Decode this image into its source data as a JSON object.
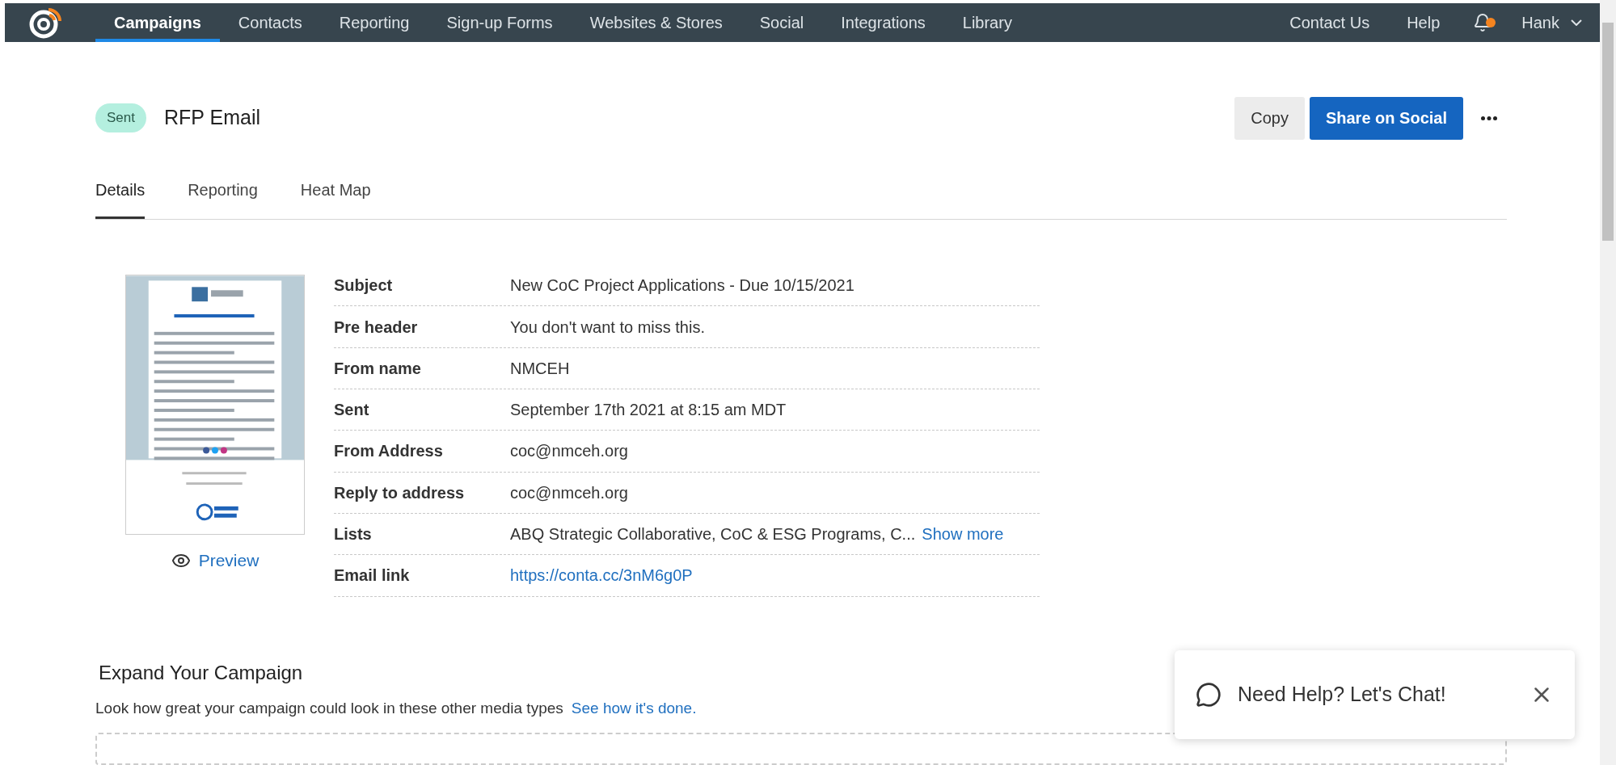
{
  "nav": {
    "items": [
      {
        "label": "Campaigns",
        "selected": true
      },
      {
        "label": "Contacts",
        "selected": false
      },
      {
        "label": "Reporting",
        "selected": false
      },
      {
        "label": "Sign-up Forms",
        "selected": false
      },
      {
        "label": "Websites & Stores",
        "selected": false
      },
      {
        "label": "Social",
        "selected": false
      },
      {
        "label": "Integrations",
        "selected": false
      },
      {
        "label": "Library",
        "selected": false
      }
    ],
    "right_links": [
      "Contact Us",
      "Help"
    ],
    "notification_dot": true,
    "user": "Hank"
  },
  "campaign": {
    "status": "Sent",
    "title": "RFP Email",
    "buttons": [
      {
        "label": "Copy",
        "kind": "secondary"
      },
      {
        "label": "Share on Social",
        "kind": "primary"
      }
    ]
  },
  "tabs": [
    {
      "label": "Details",
      "selected": true
    },
    {
      "label": "Reporting",
      "selected": false
    },
    {
      "label": "Heat Map",
      "selected": false
    }
  ],
  "preview": {
    "label": "Preview"
  },
  "details": [
    {
      "label": "Subject",
      "value": "New CoC Project Applications - Due 10/15/2021",
      "kind": "text"
    },
    {
      "label": "Pre header",
      "value": "You don't want to miss this.",
      "kind": "text"
    },
    {
      "label": "From name",
      "value": "NMCEH",
      "kind": "text"
    },
    {
      "label": "Sent",
      "value": "September 17th 2021 at 8:15 am MDT",
      "kind": "text"
    },
    {
      "label": "From Address",
      "value": "coc@nmceh.org",
      "kind": "text"
    },
    {
      "label": "Reply to address",
      "value": "coc@nmceh.org",
      "kind": "text"
    },
    {
      "label": "Lists",
      "value": "ABQ Strategic Collaborative, CoC & ESG Programs, C...",
      "link": "Show more",
      "kind": "text"
    },
    {
      "label": "Email link",
      "value": "https://conta.cc/3nM6g0P",
      "kind": "link"
    }
  ],
  "expand": {
    "title": "Expand Your Campaign",
    "text": "Look how great your campaign could look in these other media types",
    "link": "See how it's done."
  },
  "chat": {
    "label": "Need Help? Let's Chat!"
  }
}
